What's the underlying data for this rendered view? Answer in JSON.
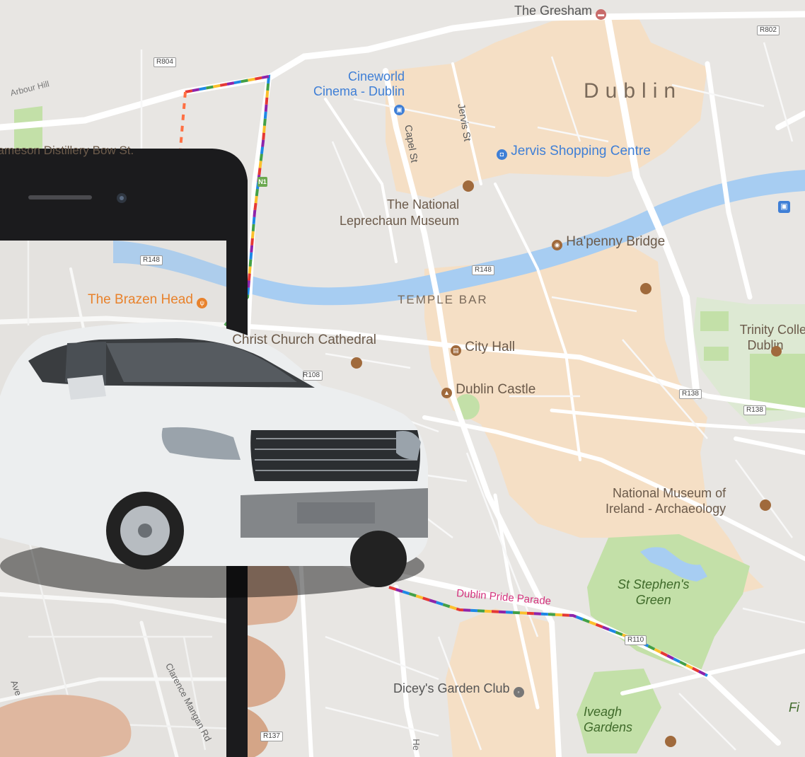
{
  "map": {
    "city_label": "Dublin",
    "neighbourhood_label": "TEMPLE BAR",
    "streets": {
      "arbour_hill": "Arbour Hill",
      "capel_st": "Capel St",
      "jervis_st": "Jervis St",
      "clarence_mangan": "Clarence Mangan Rd",
      "ave": "Ave",
      "he": "He"
    },
    "pois": {
      "gresham": "The Gresham",
      "cineworld": "Cineworld\nCinema - Dublin",
      "jervis_centre": "Jervis Shopping Centre",
      "leprechaun": "The National\nLeprechaun Museum",
      "hapenny": "Ha'penny Bridge",
      "brazen_head": "The Brazen Head",
      "jameson": "Jameson Distillery Bow St.",
      "cathedral": "Christ Church Cathedral",
      "city_hall": "City Hall",
      "dublin_castle": "Dublin Castle",
      "trinity": "Trinity College\nDublin",
      "museum": "National Museum of\nIreland - Archaeology",
      "stephens_green": "St Stephen's\nGreen",
      "diceys": "Dicey's Garden Club",
      "iveagh": "Iveagh\nGardens",
      "fi": "Fi"
    },
    "route_label": "Dublin Pride Parade",
    "road_shields": [
      "R804",
      "R802",
      "R148",
      "R148",
      "R138",
      "R138",
      "R110",
      "R137",
      "R108"
    ],
    "national_shield": "N1",
    "colors": {
      "land": "#e8e6e3",
      "river": "#a7cdf2",
      "commercial": "#f5dfc5",
      "park": "#c3e0a8",
      "poi_blue": "#3f7fd6",
      "poi_orange": "#e8822c",
      "poi_brown": "#a06a3c",
      "route_pink": "#d4327d"
    }
  },
  "overlay": {
    "device": "smartphone",
    "vehicle": "white SUV"
  }
}
